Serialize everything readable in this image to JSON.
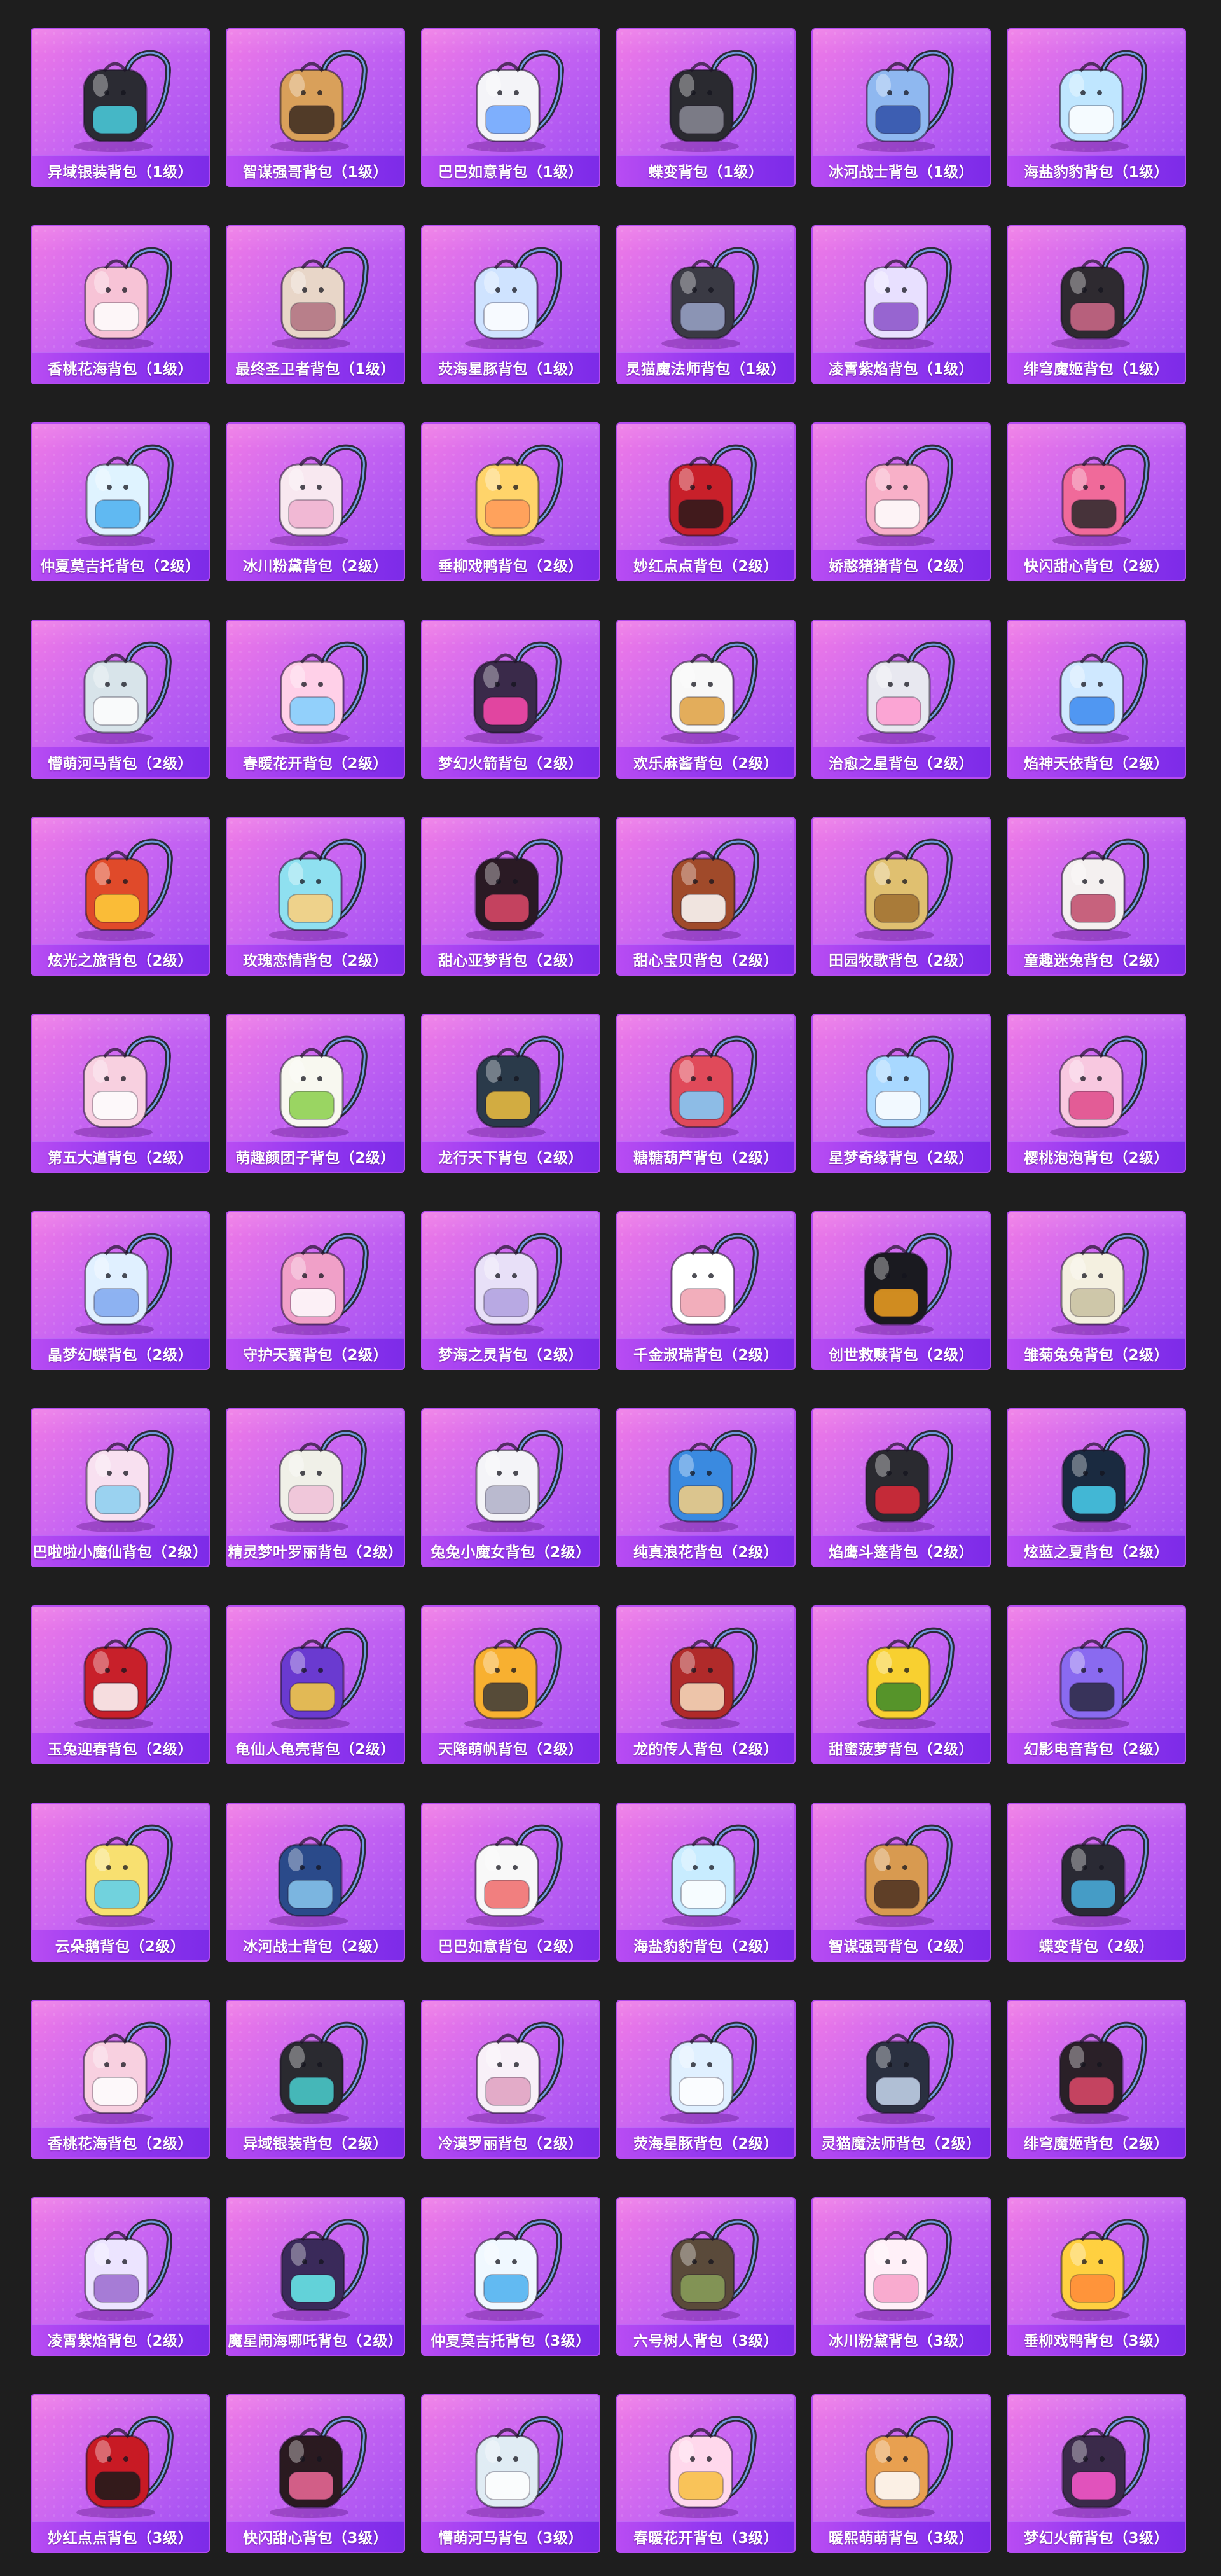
{
  "grid": {
    "columns": 6,
    "items": [
      {
        "label": "异域银装背包（1级）",
        "color": "#2b2b33",
        "accent": "#4ad0e0"
      },
      {
        "label": "智谋强哥背包（1级）",
        "color": "#d9a05a",
        "accent": "#3a2a20"
      },
      {
        "label": "巴巴如意背包（1级）",
        "color": "#f4f4f8",
        "accent": "#6aa4ff"
      },
      {
        "label": "蝶变背包（1级）",
        "color": "#2a2a30",
        "accent": "#8a8a96"
      },
      {
        "label": "冰河战士背包（1级）",
        "color": "#8fb8f0",
        "accent": "#2f4fa8"
      },
      {
        "label": "海盐豹豹背包（1级）",
        "color": "#bfe6ff",
        "accent": "#ffffff"
      },
      {
        "label": "香桃花海背包（1级）",
        "color": "#f7c3d6",
        "accent": "#ffffff"
      },
      {
        "label": "最终圣卫者背包（1级）",
        "color": "#e8d6c8",
        "accent": "#b07080"
      },
      {
        "label": "荧海星豚背包（1级）",
        "color": "#cfe3ff",
        "accent": "#ffffff"
      },
      {
        "label": "灵猫魔法师背包（1级）",
        "color": "#3a3a44",
        "accent": "#9aa4c8"
      },
      {
        "label": "凌霄紫焰背包（1级）",
        "color": "#e8e0ff",
        "accent": "#8a50c8"
      },
      {
        "label": "绯穹魔姬背包（1级）",
        "color": "#2e2a30",
        "accent": "#d06a8a"
      },
      {
        "label": "仲夏莫吉托背包（2级）",
        "color": "#dff3ff",
        "accent": "#4ab0f0"
      },
      {
        "label": "冰川粉黛背包（2级）",
        "color": "#f8e8f0",
        "accent": "#f0b0d0"
      },
      {
        "label": "垂柳戏鸭背包（2级）",
        "color": "#ffd46a",
        "accent": "#ff9a5a"
      },
      {
        "label": "妙红点点背包（2级）",
        "color": "#c8202a",
        "accent": "#2a1a1a"
      },
      {
        "label": "娇憨猪猪背包（2级）",
        "color": "#f8b0c8",
        "accent": "#ffffff"
      },
      {
        "label": "快闪甜心背包（2级）",
        "color": "#f06a9a",
        "accent": "#2a2a2a"
      },
      {
        "label": "懵萌河马背包（2级）",
        "color": "#d8e4ea",
        "accent": "#ffffff"
      },
      {
        "label": "春暖花开背包（2级）",
        "color": "#ffd0e8",
        "accent": "#7fd0ff"
      },
      {
        "label": "梦幻火箭背包（2级）",
        "color": "#3a2a4a",
        "accent": "#ff4ab0"
      },
      {
        "label": "欢乐麻酱背包（2级）",
        "color": "#f8f8f8",
        "accent": "#e0a040"
      },
      {
        "label": "治愈之星背包（2级）",
        "color": "#e8e8f0",
        "accent": "#ff9ad0"
      },
      {
        "label": "焰神天依背包（2级）",
        "color": "#cfe8ff",
        "accent": "#3a8af0"
      },
      {
        "label": "炫光之旅背包（2级）",
        "color": "#e04a2a",
        "accent": "#ffd03a"
      },
      {
        "label": "玫瑰恋情背包（2级）",
        "color": "#8fe0f0",
        "accent": "#ffd07a"
      },
      {
        "label": "甜心亚梦背包（2级）",
        "color": "#2a1a24",
        "accent": "#e04a6a"
      },
      {
        "label": "甜心宝贝背包（2级）",
        "color": "#a04a2a",
        "accent": "#ffffff"
      },
      {
        "label": "田园牧歌背包（2级）",
        "color": "#e0c070",
        "accent": "#a07030"
      },
      {
        "label": "童趣迷兔背包（2级）",
        "color": "#f4f0f0",
        "accent": "#c04a6a"
      },
      {
        "label": "第五大道背包（2级）",
        "color": "#f8d0e0",
        "accent": "#ffffff"
      },
      {
        "label": "萌趣颜团子背包（2级）",
        "color": "#f8f8f0",
        "accent": "#8ad04a"
      },
      {
        "label": "龙行天下背包（2级）",
        "color": "#2a3a4a",
        "accent": "#f0c040"
      },
      {
        "label": "糖糖葫芦背包（2级）",
        "color": "#e04a5a",
        "accent": "#7fd0ff"
      },
      {
        "label": "星梦奇缘背包（2级）",
        "color": "#a8d8ff",
        "accent": "#ffffff"
      },
      {
        "label": "樱桃泡泡背包（2级）",
        "color": "#f8c8e0",
        "accent": "#e04a8a"
      },
      {
        "label": "晶梦幻蝶背包（2级）",
        "color": "#e0f0ff",
        "accent": "#7fa8f0"
      },
      {
        "label": "守护天翼背包（2级）",
        "color": "#f0a0c8",
        "accent": "#ffffff"
      },
      {
        "label": "梦海之灵背包（2级）",
        "color": "#e8e0f8",
        "accent": "#b0a0e0"
      },
      {
        "label": "千金淑瑞背包（2级）",
        "color": "#ffffff",
        "accent": "#f0a0b0"
      },
      {
        "label": "创世救赎背包（2级）",
        "color": "#1a1a20",
        "accent": "#f0a020"
      },
      {
        "label": "雏菊兔兔背包（2级）",
        "color": "#f4f0e0",
        "accent": "#c8c0a0"
      },
      {
        "label": "巴啦啦小魔仙背包（2级）",
        "color": "#f8e0f0",
        "accent": "#8ad0f0"
      },
      {
        "label": "精灵梦叶罗丽背包（2级）",
        "color": "#f0f0e8",
        "accent": "#f0c0d8"
      },
      {
        "label": "兔兔小魔女背包（2级）",
        "color": "#f4f4f8",
        "accent": "#b0b0c8"
      },
      {
        "label": "纯真浪花背包（2级）",
        "color": "#3a8ae0",
        "accent": "#f8d080"
      },
      {
        "label": "焰鹰斗篷背包（2级）",
        "color": "#2a2a30",
        "accent": "#e02a3a"
      },
      {
        "label": "炫蓝之夏背包（2级）",
        "color": "#1a2a40",
        "accent": "#4ad0f0"
      },
      {
        "label": "玉兔迎春背包（2级）",
        "color": "#c8202a",
        "accent": "#ffffff"
      },
      {
        "label": "龟仙人龟壳背包（2级）",
        "color": "#6a3ad0",
        "accent": "#f8d040"
      },
      {
        "label": "天降萌帆背包（2级）",
        "color": "#f8b030",
        "accent": "#3a3a3a"
      },
      {
        "label": "龙的传人背包（2级）",
        "color": "#b02a2a",
        "accent": "#f8e0c0"
      },
      {
        "label": "甜蜜菠萝背包（2级）",
        "color": "#f8d030",
        "accent": "#3a8a2a"
      },
      {
        "label": "幻影电音背包（2级）",
        "color": "#8a6af0",
        "accent": "#2a2a40"
      },
      {
        "label": "云朵鹅背包（2级）",
        "color": "#f8e070",
        "accent": "#5ad0f0"
      },
      {
        "label": "冰河战士背包（2级）",
        "color": "#2a4a8a",
        "accent": "#8ac8f0"
      },
      {
        "label": "巴巴如意背包（2级）",
        "color": "#f8f8f8",
        "accent": "#f06a6a"
      },
      {
        "label": "海盐豹豹背包（2级）",
        "color": "#c8ecff",
        "accent": "#ffffff"
      },
      {
        "label": "智谋强哥背包（2级）",
        "color": "#d89a50",
        "accent": "#4a3020"
      },
      {
        "label": "蝶变背包（2级）",
        "color": "#2a2a34",
        "accent": "#4ab0e0"
      },
      {
        "label": "香桃花海背包（2级）",
        "color": "#f8d0e0",
        "accent": "#ffffff"
      },
      {
        "label": "异域银装背包（2级）",
        "color": "#2a2a30",
        "accent": "#4ad0d0"
      },
      {
        "label": "冷漠罗丽背包（2级）",
        "color": "#f8f0f8",
        "accent": "#e0a0c0"
      },
      {
        "label": "荧海星豚背包（2级）",
        "color": "#e0f0ff",
        "accent": "#ffffff"
      },
      {
        "label": "灵猫魔法师背包（2级）",
        "color": "#2a3040",
        "accent": "#c8d8f0"
      },
      {
        "label": "绯穹魔姬背包（2级）",
        "color": "#2a2028",
        "accent": "#e04a6a"
      },
      {
        "label": "凌霄紫焰背包（2级）",
        "color": "#ece4ff",
        "accent": "#9a6ad0"
      },
      {
        "label": "魔星闹海哪吒背包（2级）",
        "color": "#3a2a5a",
        "accent": "#6af0f0"
      },
      {
        "label": "仲夏莫吉托背包（3级）",
        "color": "#f0f8ff",
        "accent": "#4ab0f0"
      },
      {
        "label": "六号树人背包（3级）",
        "color": "#5a4a3a",
        "accent": "#8aa05a"
      },
      {
        "label": "冰川粉黛背包（3级）",
        "color": "#fff0f8",
        "accent": "#f8a0c8"
      },
      {
        "label": "垂柳戏鸭背包（3级）",
        "color": "#ffd040",
        "accent": "#ff8a3a"
      },
      {
        "label": "妙红点点背包（3级）",
        "color": "#c81a24",
        "accent": "#1a1a1a"
      },
      {
        "label": "快闪甜心背包（3级）",
        "color": "#2a1a20",
        "accent": "#f06a9a"
      },
      {
        "label": "懵萌河马背包（3级）",
        "color": "#e0ecf4",
        "accent": "#ffffff"
      },
      {
        "label": "春暖花开背包（3级）",
        "color": "#ffd8ec",
        "accent": "#f8c040"
      },
      {
        "label": "暖熙萌萌背包（3级）",
        "color": "#e8a050",
        "accent": "#ffffff"
      },
      {
        "label": "梦幻火箭背包（3级）",
        "color": "#3a2a4a",
        "accent": "#ff5ad0"
      }
    ]
  },
  "icons": {
    "item": "backpack-icon"
  }
}
